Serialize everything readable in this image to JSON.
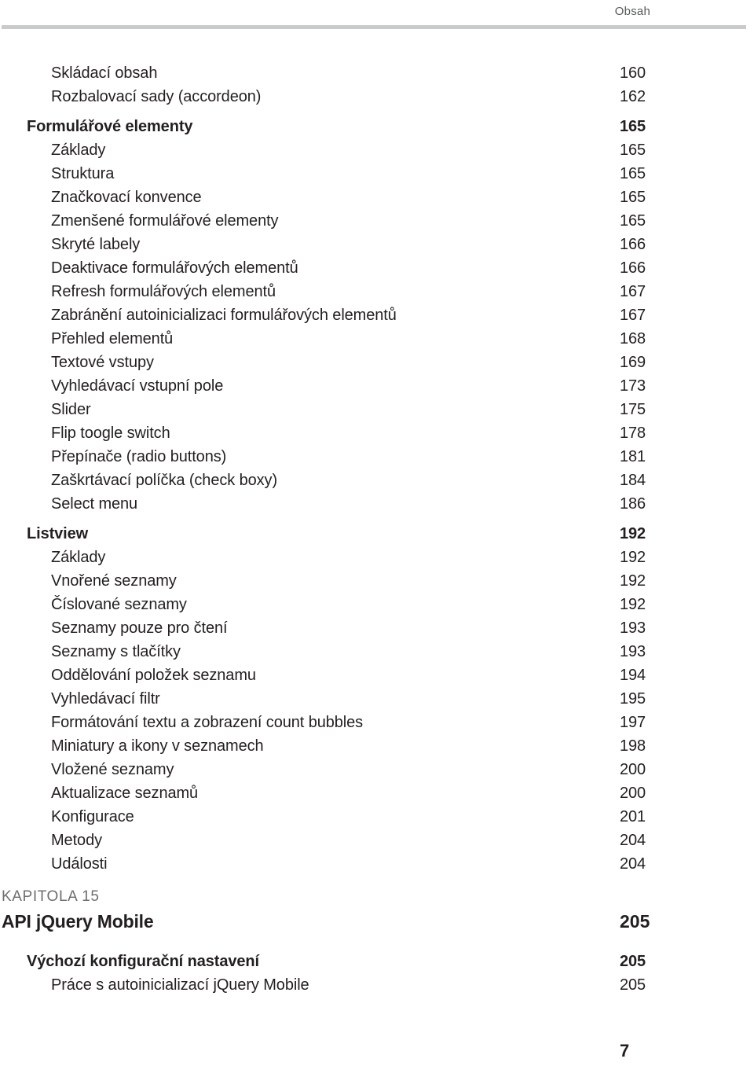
{
  "header": {
    "running_head": "Obsah"
  },
  "toc": {
    "entries": [
      {
        "label": "Skládací obsah",
        "page": "160",
        "level": "item"
      },
      {
        "label": "Rozbalovací sady (accordeon)",
        "page": "162",
        "level": "item"
      },
      {
        "label": "Formulářové elementy",
        "page": "165",
        "level": "section"
      },
      {
        "label": "Základy",
        "page": "165",
        "level": "item"
      },
      {
        "label": "Struktura",
        "page": "165",
        "level": "item"
      },
      {
        "label": "Značkovací konvence",
        "page": "165",
        "level": "item"
      },
      {
        "label": "Zmenšené formulářové elementy",
        "page": "165",
        "level": "item"
      },
      {
        "label": "Skryté labely",
        "page": "166",
        "level": "item"
      },
      {
        "label": "Deaktivace formulářových elementů",
        "page": "166",
        "level": "item"
      },
      {
        "label": "Refresh formulářových elementů",
        "page": "167",
        "level": "item"
      },
      {
        "label": "Zabránění autoinicializaci formulářových elementů",
        "page": "167",
        "level": "item"
      },
      {
        "label": "Přehled elementů",
        "page": "168",
        "level": "item"
      },
      {
        "label": "Textové vstupy",
        "page": "169",
        "level": "item"
      },
      {
        "label": "Vyhledávací vstupní pole",
        "page": "173",
        "level": "item"
      },
      {
        "label": "Slider",
        "page": "175",
        "level": "item"
      },
      {
        "label": "Flip toogle switch",
        "page": "178",
        "level": "item"
      },
      {
        "label": "Přepínače (radio buttons)",
        "page": "181",
        "level": "item"
      },
      {
        "label": "Zaškrtávací políčka (check boxy)",
        "page": "184",
        "level": "item"
      },
      {
        "label": "Select menu",
        "page": "186",
        "level": "item"
      },
      {
        "label": "Listview",
        "page": "192",
        "level": "section"
      },
      {
        "label": "Základy",
        "page": "192",
        "level": "item"
      },
      {
        "label": "Vnořené seznamy",
        "page": "192",
        "level": "item"
      },
      {
        "label": "Číslované seznamy",
        "page": "192",
        "level": "item"
      },
      {
        "label": "Seznamy pouze pro čtení",
        "page": "193",
        "level": "item"
      },
      {
        "label": "Seznamy s tlačítky",
        "page": "193",
        "level": "item"
      },
      {
        "label": "Oddělování položek seznamu",
        "page": "194",
        "level": "item"
      },
      {
        "label": "Vyhledávací filtr",
        "page": "195",
        "level": "item"
      },
      {
        "label": "Formátování textu a zobrazení count bubbles",
        "page": "197",
        "level": "item"
      },
      {
        "label": "Miniatury a ikony v seznamech",
        "page": "198",
        "level": "item"
      },
      {
        "label": "Vložené seznamy",
        "page": "200",
        "level": "item"
      },
      {
        "label": "Aktualizace seznamů",
        "page": "200",
        "level": "item"
      },
      {
        "label": "Konfigurace",
        "page": "201",
        "level": "item"
      },
      {
        "label": "Metody",
        "page": "204",
        "level": "item"
      },
      {
        "label": "Události",
        "page": "204",
        "level": "item"
      }
    ]
  },
  "chapter": {
    "kicker": "KAPITOLA 15",
    "title": "API jQuery Mobile",
    "page": "205",
    "entries": [
      {
        "label": "Výchozí konfigurační nastavení",
        "page": "205",
        "level": "section"
      },
      {
        "label": "Práce s autoinicializací jQuery Mobile",
        "page": "205",
        "level": "item"
      }
    ]
  },
  "folio": {
    "page_number": "7"
  }
}
